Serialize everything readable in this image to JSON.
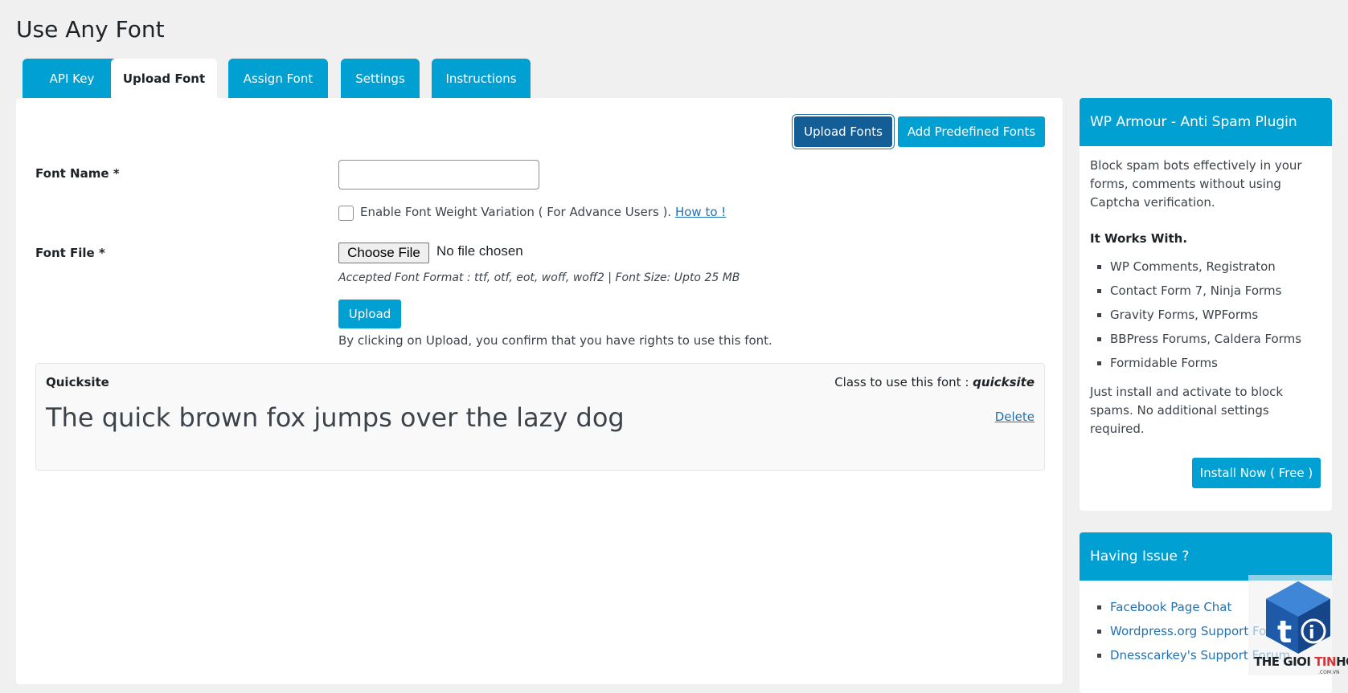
{
  "page": {
    "title": "Use Any Font"
  },
  "tabs": [
    {
      "label": "API Key",
      "active": false
    },
    {
      "label": "Upload Font",
      "active": true
    },
    {
      "label": "Assign Font",
      "active": false
    },
    {
      "label": "Settings",
      "active": false
    },
    {
      "label": "Instructions",
      "active": false
    }
  ],
  "toolbar": {
    "upload_fonts_label": "Upload Fonts",
    "add_predefined_label": "Add Predefined Fonts"
  },
  "form": {
    "font_name_label": "Font Name *",
    "font_name_value": "",
    "weight_checkbox_label": "Enable Font Weight Variation ( For Advance Users ).",
    "weight_checkbox_checked": false,
    "how_to_link": "How to !",
    "font_file_label": "Font File *",
    "choose_file_label": "Choose File",
    "file_status": "No file chosen",
    "accepted_format": "Accepted Font Format : ttf, otf, eot, woff, woff2 | Font Size: Upto 25 MB",
    "upload_label": "Upload",
    "confirm_text": "By clicking on Upload, you confirm that you have rights to use this font."
  },
  "font_list": [
    {
      "name": "Quicksite",
      "class_label": "Class to use this font :",
      "class_name": "quicksite",
      "sample": "The quick brown fox jumps over the lazy dog",
      "delete_label": "Delete"
    }
  ],
  "sidebar": {
    "armour": {
      "title": "WP Armour - Anti Spam Plugin",
      "description": "Block spam bots effectively in your forms, comments without using Captcha verification.",
      "works_with_heading": "It Works With.",
      "items": [
        "WP Comments, Registraton",
        "Contact Form 7, Ninja Forms",
        "Gravity Forms, WPForms",
        "BBPress Forums, Caldera Forms",
        "Formidable Forms"
      ],
      "footer": "Just install and activate to block spams. No additional settings required.",
      "install_label": "Install Now ( Free )"
    },
    "issue": {
      "title": "Having Issue ?",
      "links": [
        "Facebook Page Chat",
        "Wordpress.org Support Forum",
        "Dnesscarkey's Support Forum"
      ]
    }
  },
  "watermark": {
    "text_dark": "THE GIOI ",
    "text_red": "TIN",
    "text_dark2": "HOC",
    "sub": ".COM.VN"
  },
  "colors": {
    "accent": "#00a0d2",
    "accent_dark": "#135e96",
    "link": "#2271b1",
    "background": "#f0f0f1"
  }
}
